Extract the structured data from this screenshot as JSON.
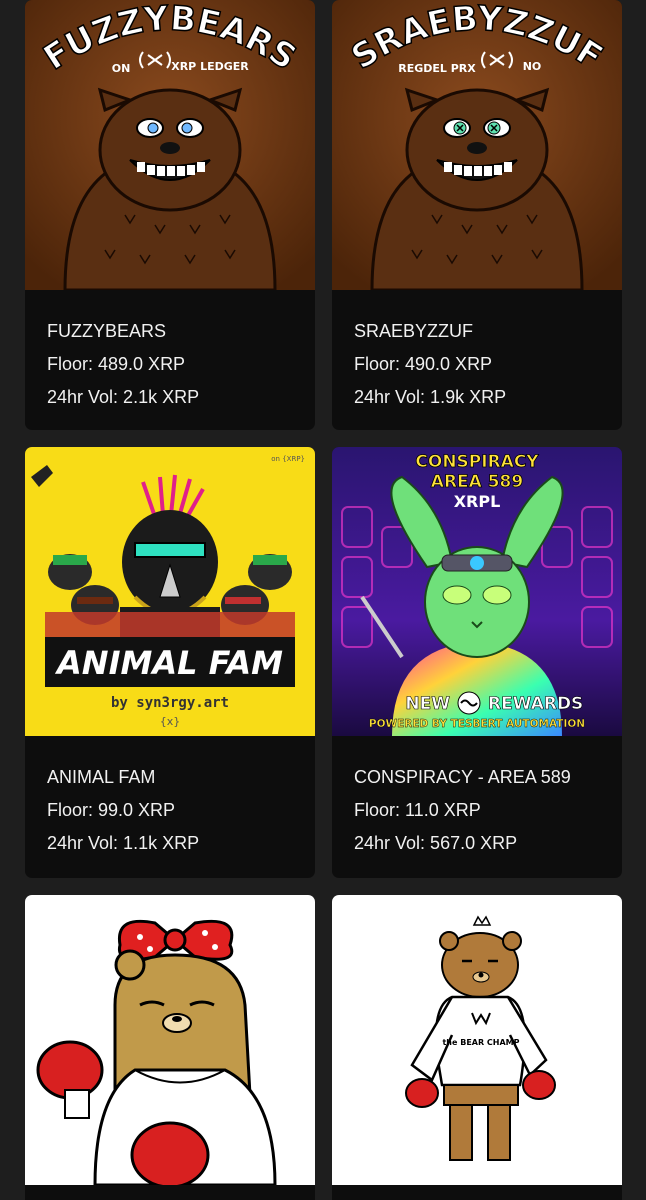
{
  "collections": [
    {
      "name": "FUZZYBEARS",
      "floor": "Floor: 489.0 XRP",
      "volume": "24hr Vol: 2.1k XRP",
      "art": {
        "title": "FUZZYBEARS",
        "left_text": "ON",
        "right_text": "XRP LEDGER",
        "eye_style": "blue",
        "bg": "#6a3614"
      }
    },
    {
      "name": "SRAEBYZZUF",
      "floor": "Floor: 490.0 XRP",
      "volume": "24hr Vol: 1.9k XRP",
      "art": {
        "title": "SRAEBYZZUF",
        "left_text": "REGDEL PRX",
        "right_text": "NO",
        "eye_style": "green",
        "bg": "#6a3614"
      }
    },
    {
      "name": "ANIMAL FAM",
      "floor": "Floor: 99.0 XRP",
      "volume": "24hr Vol: 1.1k XRP",
      "art": {
        "corner_tag": "on {XRP}",
        "banner": "ANIMAL FAM",
        "byline": "by syn3rgy.art",
        "logo": "{x}",
        "bg": "#f8dc17"
      }
    },
    {
      "name": "CONSPIRACY - AREA 589",
      "floor": "Floor: 11.0 XRP",
      "volume": "24hr Vol: 567.0 XRP",
      "art": {
        "title1": "CONSPIRACY",
        "title2": "AREA 589",
        "title3": "XRPL",
        "rewards_left": "NEW",
        "rewards_right": "REWARDS",
        "powered": "POWERED BY TESBERT AUTOMATION",
        "bg": "#3b1a8a"
      }
    },
    {
      "art": {
        "bg": "#ffffff"
      }
    },
    {
      "art": {
        "shirt_text": "the BEAR CHAMP",
        "bg": "#ffffff"
      }
    }
  ],
  "colors": {
    "page_bg": "#1e1e1e",
    "card_bg": "#0d0d0d",
    "text": "#f1f1f1"
  }
}
